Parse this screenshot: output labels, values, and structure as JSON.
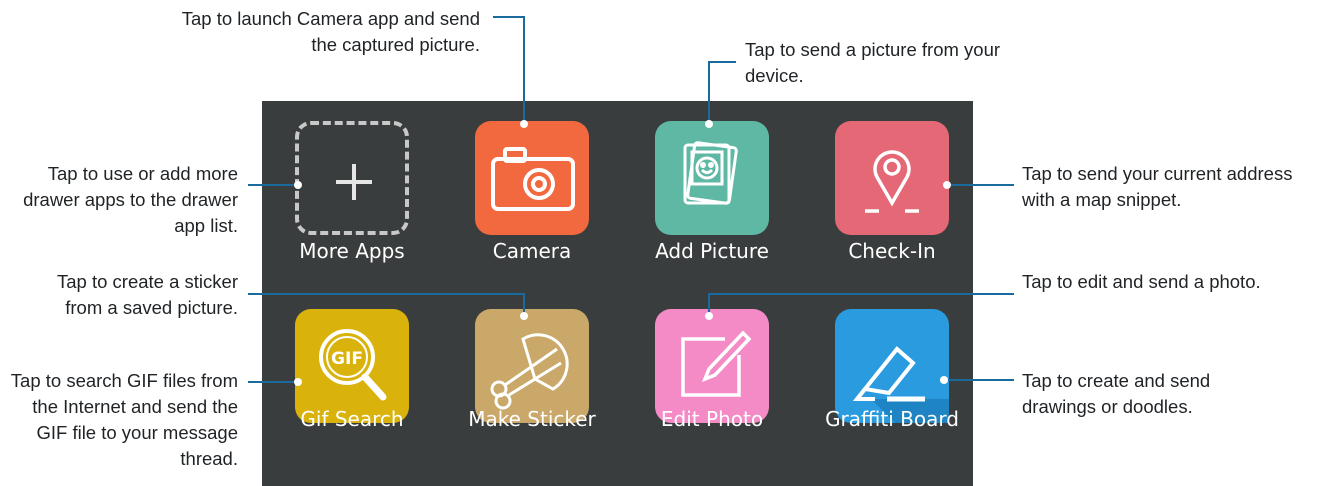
{
  "apps": {
    "more_apps": "More Apps",
    "camera": "Camera",
    "add_picture": "Add Picture",
    "check_in": "Check-In",
    "gif_search": "Gif Search",
    "make_sticker": "Make Sticker",
    "edit_photo": "Edit Photo",
    "graffiti_board": "Graffiti Board",
    "gif_icon_text": "GIF"
  },
  "callouts": {
    "camera": "Tap to launch Camera app and send the captured picture.",
    "add_picture": "Tap to send a picture from your device.",
    "more_apps": "Tap to use or add more drawer apps to the drawer app list.",
    "check_in": "Tap to send your current address with a map snippet.",
    "make_sticker": "Tap to create a sticker from a saved picture.",
    "edit_photo": "Tap to edit and send a photo.",
    "gif_search": "Tap to search GIF files from the Internet and send the GIF file to your message thread.",
    "graffiti_board": "Tap to create and send drawings or doodles."
  },
  "colors": {
    "panel": "#3a3d3d",
    "camera": "#f2683f",
    "add_picture": "#5fb8a4",
    "check_in": "#e46875",
    "gif_search": "#d9b20b",
    "make_sticker": "#c9a86a",
    "edit_photo": "#f48bc7",
    "graffiti_board": "#2b9be0",
    "callout_line": "#1a6a9e"
  }
}
